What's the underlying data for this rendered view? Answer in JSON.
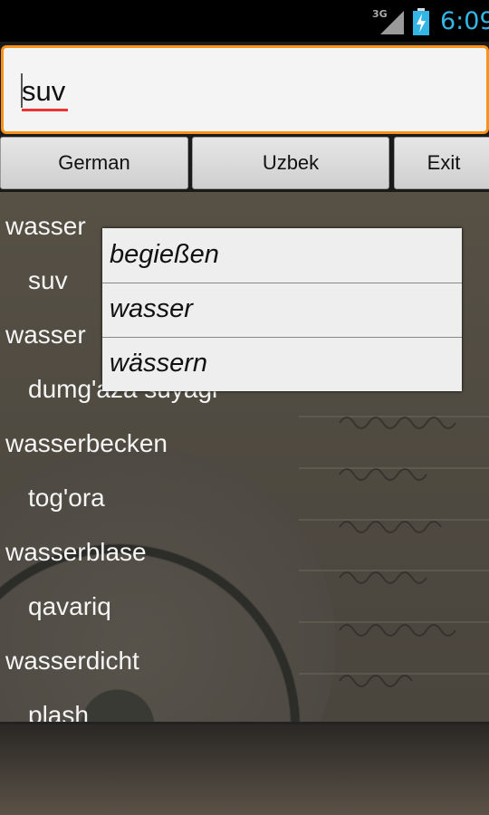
{
  "status_bar": {
    "network": "3G",
    "time": "6:09",
    "signal_icon": "signal-icon",
    "battery_icon": "battery-charging-icon",
    "time_color": "#33b5e5"
  },
  "search": {
    "value": "suv",
    "border_color": "#f7931a"
  },
  "buttons": {
    "source_language": "German",
    "target_language": "Uzbek",
    "exit": "Exit"
  },
  "results": [
    {
      "word": "wasser",
      "translation": "suv"
    },
    {
      "word": "wasser",
      "translation": "dumg'aza suyagi"
    },
    {
      "word": "wasserbecken",
      "translation": "tog'ora"
    },
    {
      "word": "wasserblase",
      "translation": "qavariq"
    },
    {
      "word": "wasserdicht",
      "translation": "plash"
    }
  ],
  "suggestions": [
    "begießen",
    "wasser",
    "wässern"
  ]
}
